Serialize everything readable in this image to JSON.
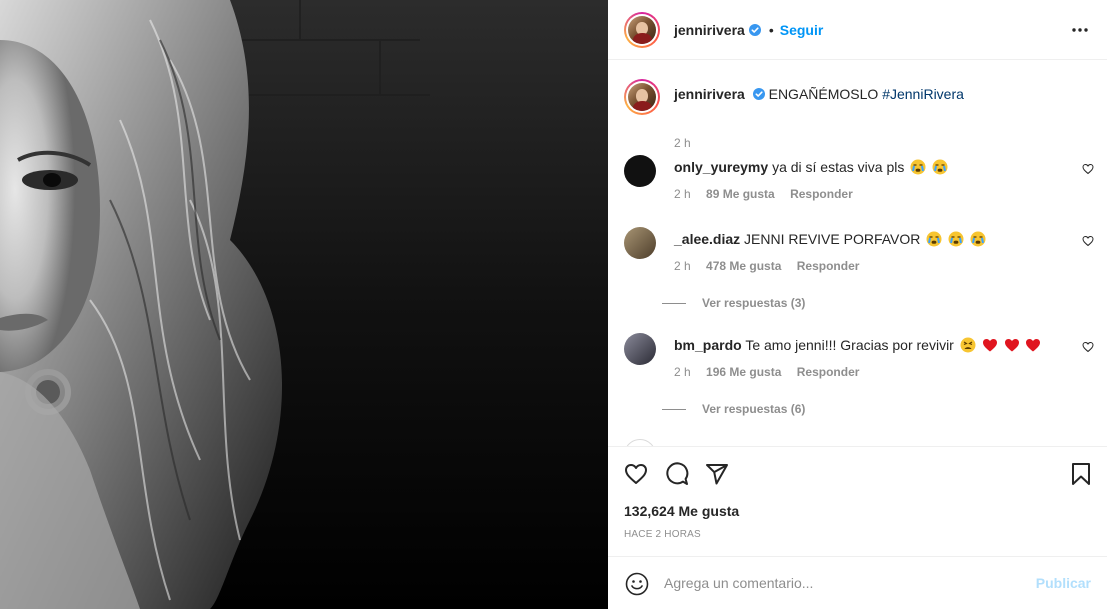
{
  "post": {
    "image_alt": "Black and white portrait photo"
  },
  "header": {
    "username": "jennirivera",
    "separator": "•",
    "follow_label": "Seguir"
  },
  "caption": {
    "username": "jennirivera",
    "text": "ENGAÑÉMOSLO",
    "hashtag": "#JenniRivera",
    "time": "2 h"
  },
  "comments": [
    {
      "username": "only_yureymy",
      "text": "ya di sí estas viva pls",
      "emojis": [
        "crying-face",
        "crying-face"
      ],
      "time": "2 h",
      "likes": "89 Me gusta",
      "reply_label": "Responder",
      "avatar_color": "#111111"
    },
    {
      "username": "_alee.diaz",
      "text": "JENNI REVIVE PORFAVOR",
      "emojis": [
        "crying-face",
        "crying-face",
        "crying-face"
      ],
      "time": "2 h",
      "likes": "478 Me gusta",
      "reply_label": "Responder",
      "view_replies": "Ver respuestas (3)",
      "avatar_color": "#7a6a4e"
    },
    {
      "username": "bm_pardo",
      "text": "Te amo jenni!!! Gracias por revivir",
      "emojis": [
        "tired-face",
        "red-heart",
        "red-heart",
        "red-heart"
      ],
      "time": "2 h",
      "likes": "196 Me gusta",
      "reply_label": "Responder",
      "view_replies": "Ver respuestas (6)",
      "avatar_color": "#3d3d4a"
    }
  ],
  "actions": {
    "like_icon": "heart-outline-icon",
    "comment_icon": "comment-bubble-icon",
    "share_icon": "paper-plane-icon",
    "save_icon": "bookmark-icon",
    "likes_count": "132,624 Me gusta",
    "posted_ago": "HACE 2 HORAS"
  },
  "composer": {
    "placeholder": "Agrega un comentario...",
    "publish_label": "Publicar"
  },
  "colors": {
    "accent": "#0095f6",
    "publish_disabled": "#b2dffc",
    "secondary_text": "#8e8e8e",
    "hashtag": "#00376b",
    "verified": "#3897f0"
  }
}
